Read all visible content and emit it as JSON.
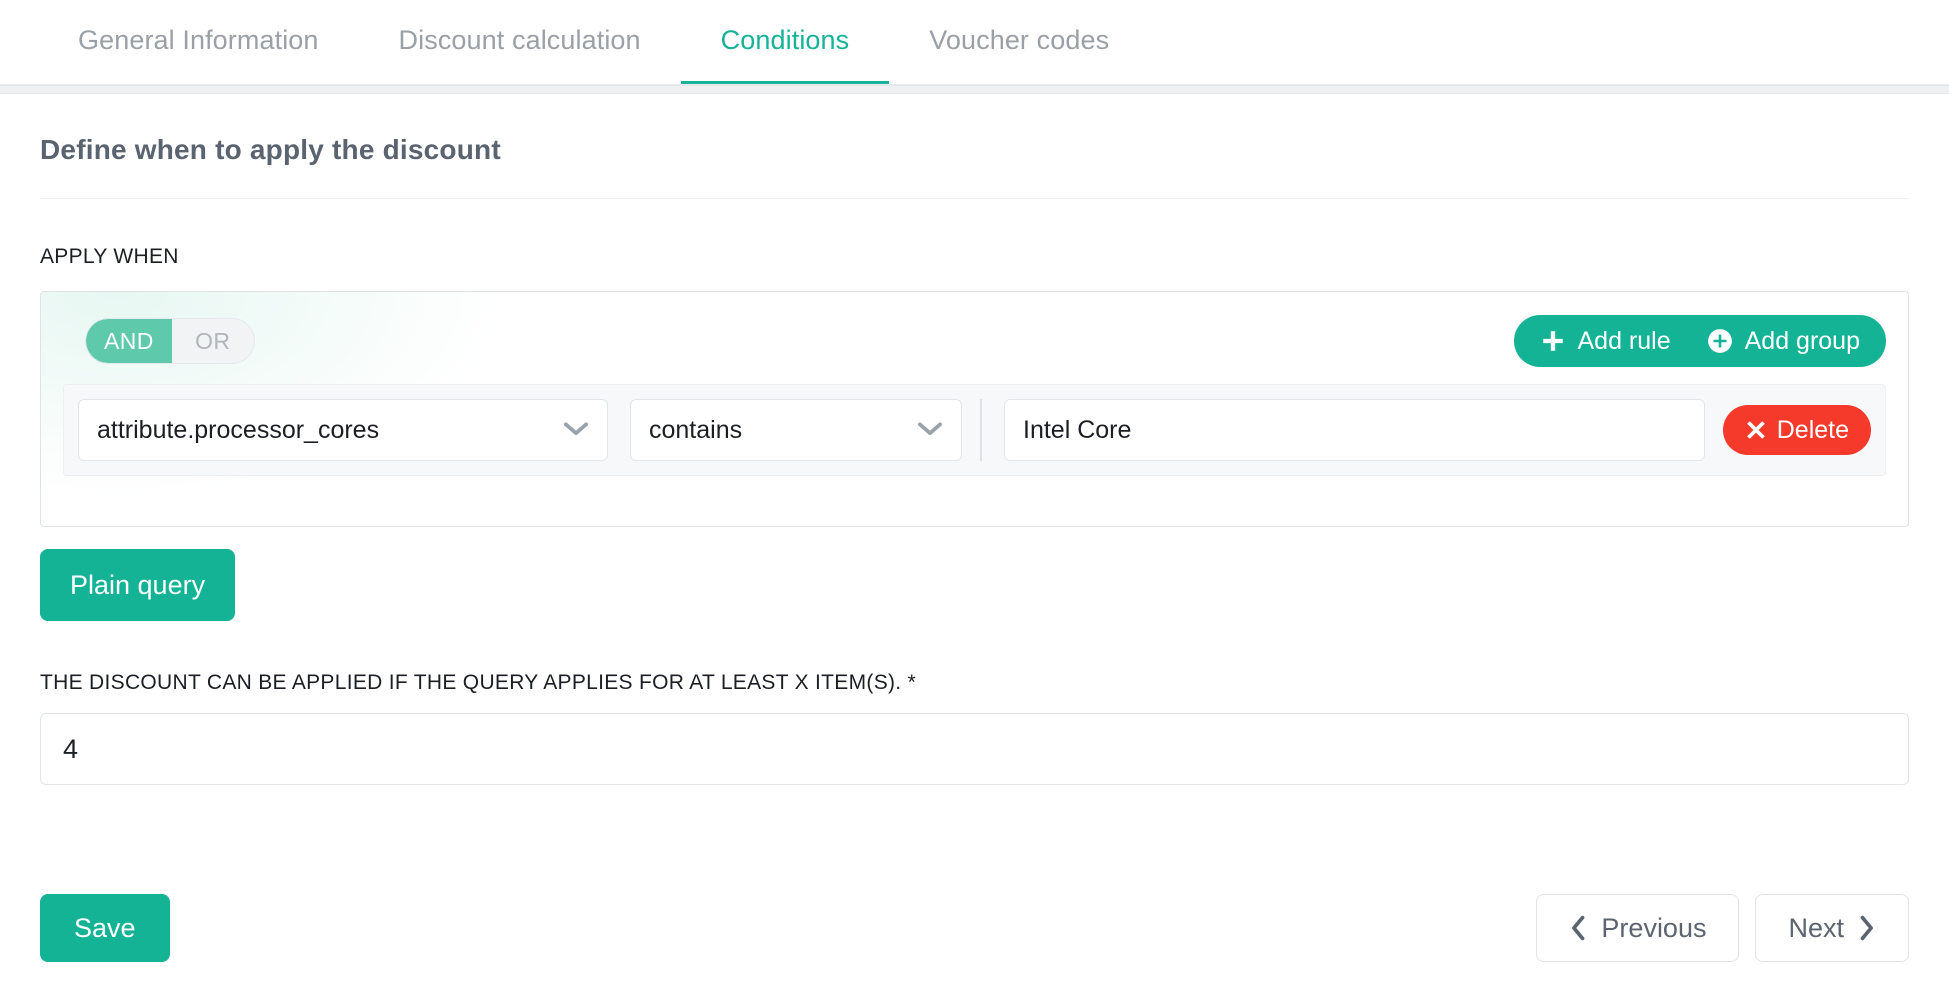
{
  "tabs": [
    {
      "label": "General Information",
      "active": false
    },
    {
      "label": "Discount calculation",
      "active": false
    },
    {
      "label": "Conditions",
      "active": true
    },
    {
      "label": "Voucher codes",
      "active": false
    }
  ],
  "page": {
    "title": "Define when to apply the discount",
    "apply_when_label": "APPLY WHEN",
    "min_items_label": "THE DISCOUNT CAN BE APPLIED IF THE QUERY APPLIES FOR AT LEAST X ITEM(S). *",
    "min_items_value": "4",
    "min_items_placeholder": ""
  },
  "query_builder": {
    "condition": {
      "and_label": "AND",
      "or_label": "OR",
      "selected": "AND"
    },
    "add_rule_label": "Add rule",
    "add_group_label": "Add group",
    "plain_query_label": "Plain query",
    "rules": [
      {
        "field": "attribute.processor_cores",
        "operator": "contains",
        "value": "Intel Core",
        "value_placeholder": "",
        "delete_label": "Delete"
      }
    ]
  },
  "footer": {
    "save_label": "Save",
    "previous_label": "Previous",
    "next_label": "Next"
  },
  "icons": {
    "plus": "plus-icon",
    "circle_plus": "circle-plus-icon",
    "times": "times-icon",
    "chevron_down": "chevron-down-icon",
    "chevron_left": "chevron-left-icon",
    "chevron_right": "chevron-right-icon"
  },
  "colors": {
    "accent_teal": "#15b395",
    "toggle_teal": "#5fc9ab",
    "danger_red": "#f5392b",
    "text_gray": "#5a6370",
    "muted_gray": "#9aa0a6"
  }
}
